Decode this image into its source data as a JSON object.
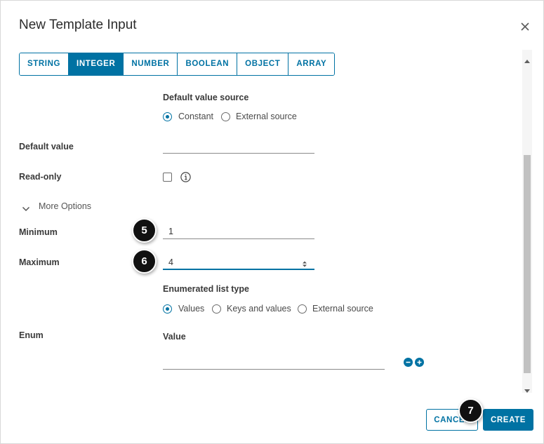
{
  "dialog": {
    "title": "New Template Input"
  },
  "tabs": [
    {
      "label": "STRING",
      "active": false
    },
    {
      "label": "INTEGER",
      "active": true
    },
    {
      "label": "NUMBER",
      "active": false
    },
    {
      "label": "BOOLEAN",
      "active": false
    },
    {
      "label": "OBJECT",
      "active": false
    },
    {
      "label": "ARRAY",
      "active": false
    }
  ],
  "default_value_source": {
    "label": "Default value source",
    "options": [
      {
        "label": "Constant",
        "selected": true
      },
      {
        "label": "External source",
        "selected": false
      }
    ]
  },
  "default_value": {
    "label": "Default value",
    "value": ""
  },
  "read_only": {
    "label": "Read-only",
    "checked": false
  },
  "more_options": {
    "label": "More Options"
  },
  "minimum": {
    "label": "Minimum",
    "value": "1"
  },
  "maximum": {
    "label": "Maximum",
    "value": "4"
  },
  "enumerated_list_type": {
    "label": "Enumerated list type",
    "options": [
      {
        "label": "Values",
        "selected": true
      },
      {
        "label": "Keys and values",
        "selected": false
      },
      {
        "label": "External source",
        "selected": false
      }
    ]
  },
  "enum": {
    "label": "Enum",
    "column_header": "Value",
    "value": ""
  },
  "badges": [
    "5",
    "6",
    "7"
  ],
  "footer": {
    "cancel_label": "CANCEL",
    "create_label": "CREATE"
  },
  "colors": {
    "accent": "#0072a3",
    "badge": "#111111"
  }
}
